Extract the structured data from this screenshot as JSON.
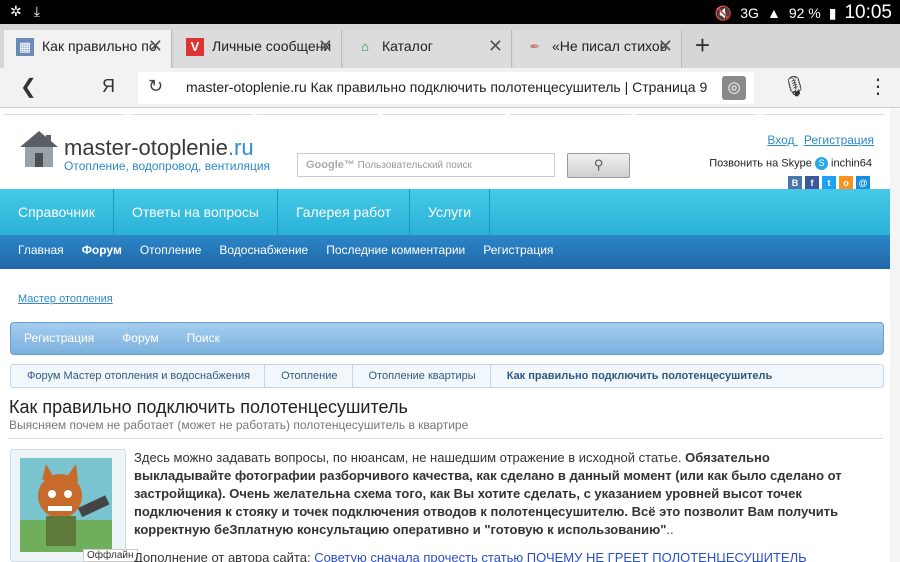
{
  "status": {
    "network": "3G",
    "battery": "92 %",
    "time": "10:05"
  },
  "tabs": [
    {
      "title": "Как правильно по",
      "favicon": "grid-icon",
      "active": true
    },
    {
      "title": "Личные сообщени",
      "favicon": "v-icon",
      "active": false
    },
    {
      "title": "Каталог",
      "favicon": "house-icon",
      "active": false
    },
    {
      "title": "«Не писал стихов",
      "favicon": "quill-icon",
      "active": false
    }
  ],
  "address": {
    "url": "master-otoplenie.ru Как правильно подключить полотенцесушитель | Страница 9",
    "yandex_label": "Я"
  },
  "site": {
    "logo_main": "master-otoplenie",
    "logo_tld": ".ru",
    "logo_sub": "Отопление, водопровод, вентиляция",
    "search_google": "Google™",
    "search_placeholder": "Пользовательский поиск",
    "login": "Вход",
    "register": "Регистрация",
    "skype_text": "Позвонить на Skype",
    "skype_user": "inchin64"
  },
  "nav1": [
    "Справочник",
    "Ответы на вопросы",
    "Галерея работ",
    "Услуги"
  ],
  "nav2": [
    "Главная",
    "Форум",
    "Отопление",
    "Водоснабжение",
    "Последние комментарии",
    "Регистрация"
  ],
  "master_link": "Мастер отопления",
  "forum_nav": [
    "Регистрация",
    "Форум",
    "Поиск"
  ],
  "breadcrumbs": [
    "Форум Мастер отопления и водоснабжения",
    "Отопление",
    "Отопление квартиры",
    "Как правильно подключить полотенцесушитель"
  ],
  "thread": {
    "title": "Как правильно подключить полотенцесушитель",
    "description": "Выясняем почем не работает (может не работать) полотенцесушитель в квартире"
  },
  "post": {
    "user_status": "Оффлайн",
    "intro": "Здесь можно задавать вопросы, по нюансам, не нашедшим отражение в исходной статье.",
    "bold": "Обязательно выкладывайте фотографии разборчивого качества, как сделано в данный момент (или как было сделано от застройщика). Очень желательна схема того, как Вы хотите сделать, с указанием уровней высот точек подключения к стояку и точек подключения отводов к полотенцесушителю. Всё это позволит Вам получить корректную беЗплатную консультацию оперативно и \"готовую к использованию\"",
    "bold_tail": "..",
    "addendum_label": "Дополнение от автора сайта:",
    "addendum_link": "Советую сначала прочесть статью ПОЧЕМУ НЕ ГРЕЕТ ПОЛОТЕНЦЕСУШИТЕЛЬ"
  },
  "colors": {
    "nav1": "#2ab2d6",
    "nav2": "#2067a8",
    "link": "#2b8ac9"
  }
}
